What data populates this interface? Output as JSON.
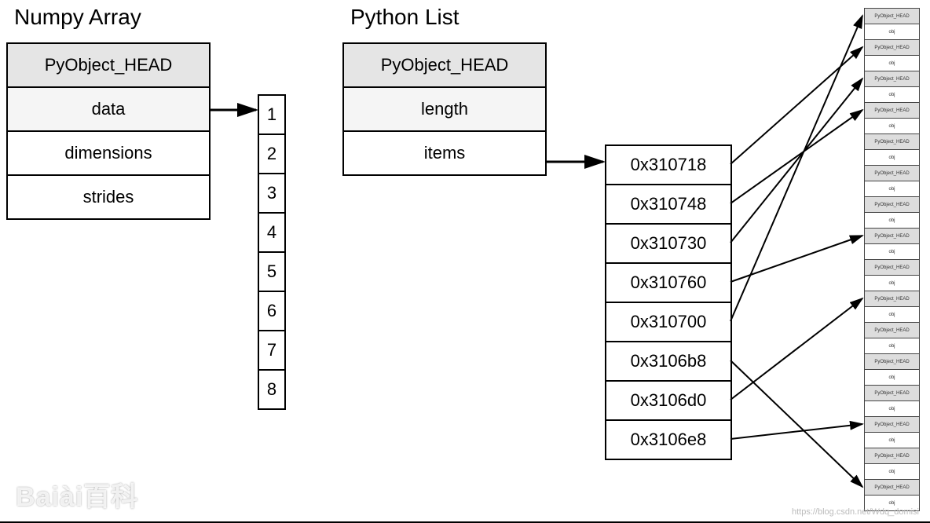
{
  "numpy": {
    "title": "Numpy Array",
    "rows": [
      "PyObject_HEAD",
      "data",
      "dimensions",
      "strides"
    ]
  },
  "pylist": {
    "title": "Python List",
    "rows": [
      "PyObject_HEAD",
      "length",
      "items"
    ]
  },
  "data_values": [
    "1",
    "2",
    "3",
    "4",
    "5",
    "6",
    "7",
    "8"
  ],
  "pointers": [
    "0x310718",
    "0x310748",
    "0x310730",
    "0x310760",
    "0x310700",
    "0x3106b8",
    "0x3106d0",
    "0x3106e8"
  ],
  "heap_cell_head": "PyObject_HEAD",
  "heap_cell_body": "obj",
  "watermark": "Baiài百科",
  "credit": "https://blog.csdn.net/Wdq_domisi"
}
